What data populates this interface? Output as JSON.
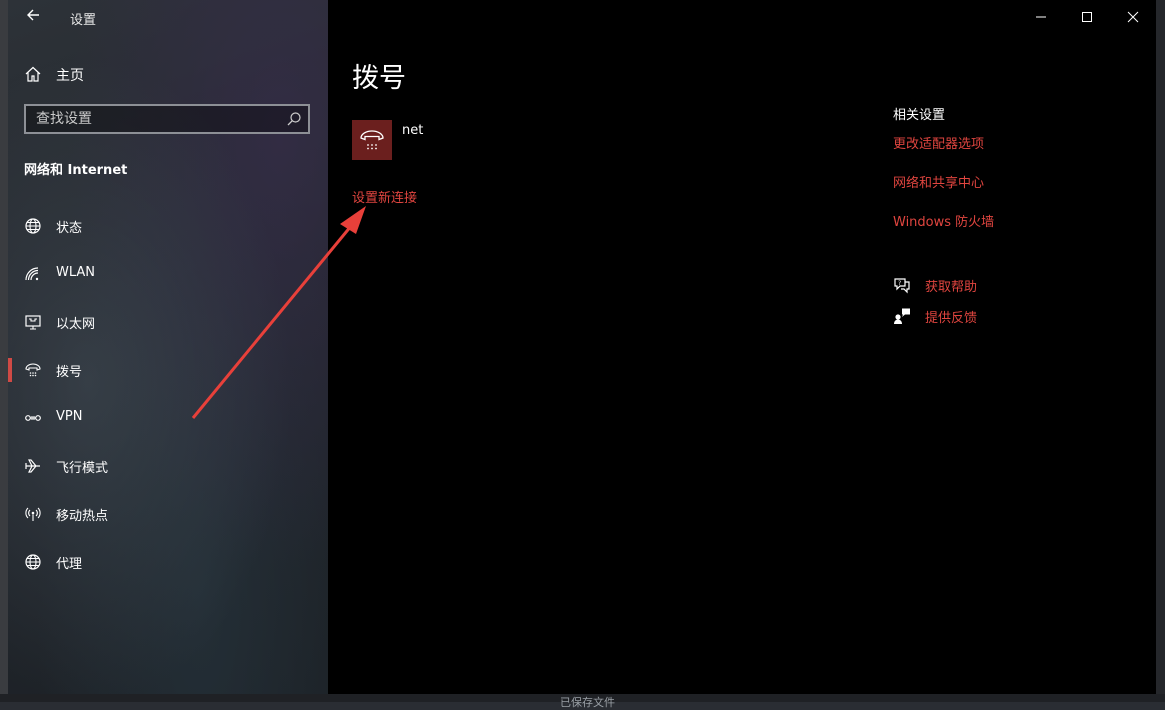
{
  "app_title": "设置",
  "home_label": "主页",
  "search": {
    "placeholder": "查找设置"
  },
  "section_title": "网络和 Internet",
  "nav": [
    {
      "label": "状态",
      "icon": "globe-icon"
    },
    {
      "label": "WLAN",
      "icon": "wifi-icon"
    },
    {
      "label": "以太网",
      "icon": "ethernet-icon"
    },
    {
      "label": "拨号",
      "icon": "dialup-icon"
    },
    {
      "label": "VPN",
      "icon": "vpn-icon"
    },
    {
      "label": "飞行模式",
      "icon": "airplane-icon"
    },
    {
      "label": "移动热点",
      "icon": "hotspot-icon"
    },
    {
      "label": "代理",
      "icon": "globe-icon"
    }
  ],
  "page_title": "拨号",
  "connection": {
    "name": "net",
    "icon": "phone-icon"
  },
  "setup_new_connection": "设置新连接",
  "related": {
    "title": "相关设置",
    "links": [
      "更改适配器选项",
      "网络和共享中心",
      "Windows 防火墙"
    ]
  },
  "help": [
    {
      "label": "获取帮助",
      "icon": "help-chat-icon"
    },
    {
      "label": "提供反馈",
      "icon": "feedback-icon"
    }
  ],
  "desktop_text": "已保存文件",
  "colors": {
    "accent": "#e0453f",
    "tile": "#6b1f1e",
    "background": "#000000"
  }
}
